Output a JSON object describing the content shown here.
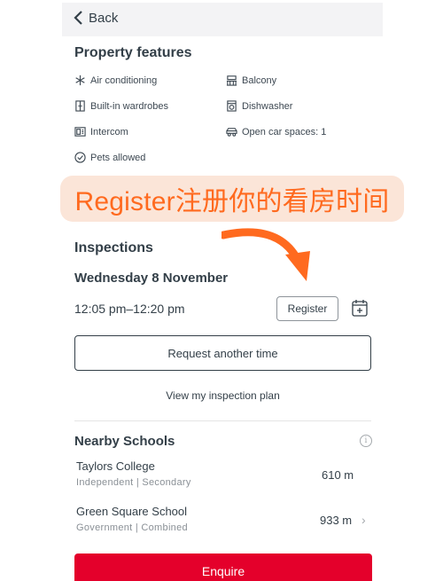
{
  "nav": {
    "back_label": "Back"
  },
  "features": {
    "title": "Property features",
    "items": [
      {
        "icon": "snowflake-icon",
        "label": "Air conditioning"
      },
      {
        "icon": "balcony-icon",
        "label": "Balcony"
      },
      {
        "icon": "wardrobe-icon",
        "label": "Built-in wardrobes"
      },
      {
        "icon": "dishwasher-icon",
        "label": "Dishwasher"
      },
      {
        "icon": "intercom-icon",
        "label": "Intercom"
      },
      {
        "icon": "car-icon",
        "label": "Open car spaces: 1"
      },
      {
        "icon": "paw-icon",
        "label": "Pets allowed"
      }
    ]
  },
  "banner": {
    "text": "Register注册你的看房时间",
    "color": "#ff6a1f"
  },
  "inspections": {
    "title": "Inspections",
    "date": "Wednesday 8 November",
    "time": "12:05 pm–12:20 pm",
    "register_label": "Register",
    "request_label": "Request another time",
    "plan_label": "View my inspection plan"
  },
  "schools": {
    "title": "Nearby Schools",
    "items": [
      {
        "name": "Taylors College",
        "meta": "Independent | Secondary",
        "distance": "610 m"
      },
      {
        "name": "Green Square School",
        "meta": "Government | Combined",
        "distance": "933 m"
      }
    ]
  },
  "cta": {
    "enquire_label": "Enquire",
    "color": "#e4002b"
  }
}
